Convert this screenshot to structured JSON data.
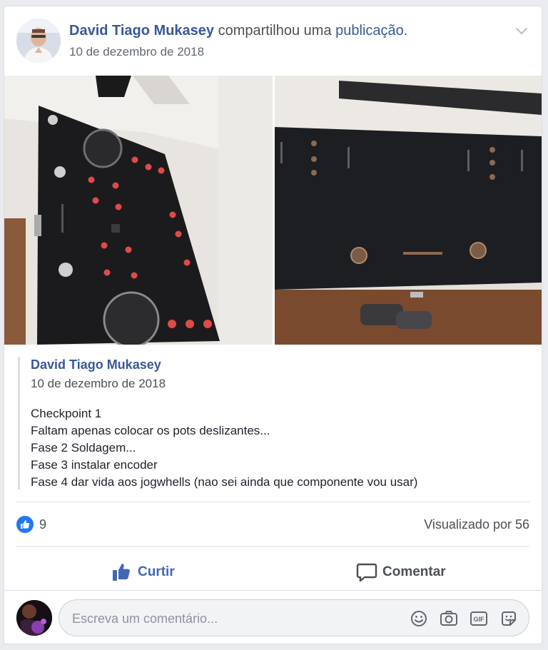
{
  "post": {
    "author": "David Tiago Mukasey",
    "verb": "compartilhou uma",
    "link_text": "publicação",
    "link_suffix": ".",
    "date": "10 de dezembro de 2018"
  },
  "photos": [
    {
      "alt": "black controller box with knobs and red buttons"
    },
    {
      "alt": "black panel with drilled holes"
    }
  ],
  "shared": {
    "author": "David Tiago Mukasey",
    "date": "10 de dezembro de 2018",
    "lines": [
      "Checkpoint 1",
      "Faltam apenas colocar os pots deslizantes...",
      "Fase 2 Soldagem...",
      "Fase 3 instalar encoder",
      "Fase 4 dar vida aos jogwhells (nao sei ainda que componente vou usar)"
    ]
  },
  "stats": {
    "likes": "9",
    "views": "Visualizado por 56"
  },
  "actions": {
    "like_label": "Curtir",
    "comment_label": "Comentar"
  },
  "composer": {
    "placeholder": "Escreva um comentário...",
    "icons": [
      "emoji-icon",
      "camera-icon",
      "gif-icon",
      "sticker-icon"
    ]
  },
  "colors": {
    "brand_blue": "#385898",
    "like_blue": "#4267b2",
    "text_gray": "#4b4f56",
    "background": "#e9ebee"
  }
}
